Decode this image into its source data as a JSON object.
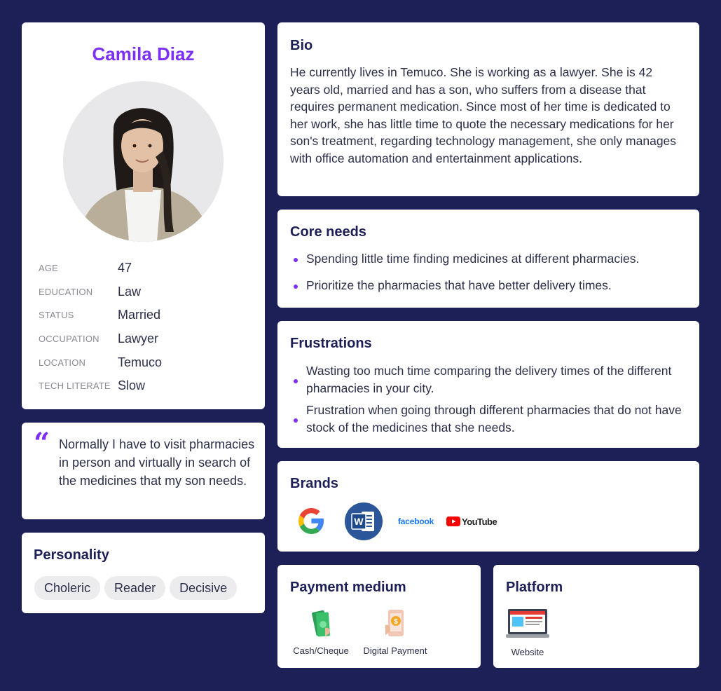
{
  "profile": {
    "name": "Camila Diaz",
    "facts": [
      {
        "label": "AGE",
        "value": "47"
      },
      {
        "label": "EDUCATION",
        "value": "Law"
      },
      {
        "label": "STATUS",
        "value": "Married"
      },
      {
        "label": "OCCUPATION",
        "value": "Lawyer"
      },
      {
        "label": "LOCATION",
        "value": "Temuco"
      },
      {
        "label": "TECH LITERATE",
        "value": "Slow"
      }
    ]
  },
  "quote": {
    "mark": "“",
    "text": "Normally I have to visit pharmacies in person and virtually in search of the medicines that my son needs."
  },
  "personality": {
    "title": "Personality",
    "traits": [
      "Choleric",
      "Reader",
      "Decisive"
    ]
  },
  "bio": {
    "title": "Bio",
    "text": "He currently lives in Temuco. She is working as a lawyer. She is 42 years old, married and has a son, who suffers from a disease that requires permanent medication. Since most of her time is dedicated to her work, she has little time to quote the necessary medications for her son's treatment, regarding technology management, she only manages with office automation and entertainment applications."
  },
  "core_needs": {
    "title": "Core needs",
    "items": [
      "Spending little time finding medicines at different pharmacies.",
      "Prioritize the pharmacies that have better delivery times."
    ]
  },
  "frustrations": {
    "title": "Frustrations",
    "items": [
      "Wasting too much time comparing the delivery times of the different pharmacies in your city.",
      "Frustration when going through different pharmacies that do not have stock of the medicines that she needs."
    ]
  },
  "brands": {
    "title": "Brands",
    "items": [
      {
        "icon": "google-logo-icon"
      },
      {
        "icon": "microsoft-word-icon"
      },
      {
        "icon": "facebook-logo-icon",
        "text": "facebook"
      },
      {
        "icon": "youtube-logo-icon",
        "text": "YouTube"
      }
    ]
  },
  "payment": {
    "title": "Payment medium",
    "items": [
      {
        "icon": "cash-icon",
        "label": "Cash/Cheque"
      },
      {
        "icon": "digital-payment-icon",
        "label": "Digital Payment"
      }
    ]
  },
  "platform": {
    "title": "Platform",
    "items": [
      {
        "icon": "laptop-website-icon",
        "label": "Website"
      }
    ]
  },
  "colors": {
    "background": "#1c2057",
    "accent": "#7b2ff7",
    "card": "#ffffff",
    "chip": "#ececee"
  }
}
